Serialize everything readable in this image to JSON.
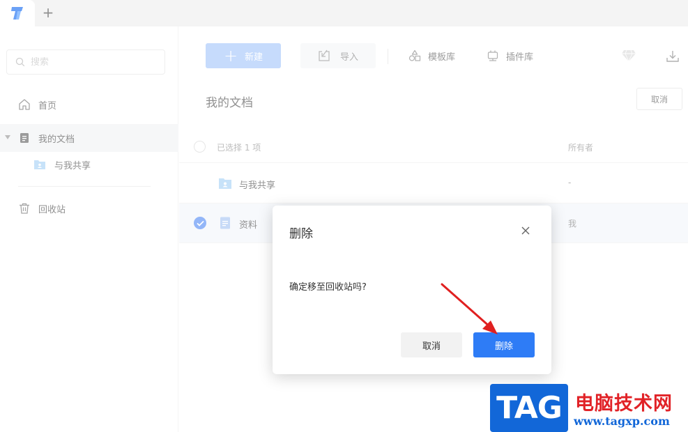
{
  "tabbar": {
    "logo": "app-logo-icon",
    "new_tab": "+"
  },
  "sidebar": {
    "search_placeholder": "搜索",
    "items": [
      {
        "label": "首页",
        "icon": "home-icon"
      },
      {
        "label": "我的文档",
        "icon": "document-icon"
      },
      {
        "label": "与我共享",
        "icon": "shared-folder-icon"
      },
      {
        "label": "回收站",
        "icon": "trash-icon"
      }
    ]
  },
  "toolbar": {
    "new_label": "新建",
    "import_label": "导入",
    "template_label": "模板库",
    "plugin_label": "插件库"
  },
  "main": {
    "title": "我的文档",
    "cancel_label": "取消",
    "selected_text": "已选择 1 项",
    "owner_header": "所有者",
    "rows": [
      {
        "name": "与我共享",
        "owner": "-",
        "type": "folder"
      },
      {
        "name": "资料",
        "owner": "我",
        "type": "document",
        "checked": true
      }
    ]
  },
  "dialog": {
    "title": "删除",
    "message": "确定移至回收站吗?",
    "cancel_label": "取消",
    "confirm_label": "删除"
  },
  "watermark": {
    "tag": "TAG",
    "cn": "电脑技术网",
    "url": "www.tagxp.com"
  },
  "colors": {
    "primary": "#2e7cf6",
    "primary_disabled": "#a8c8fb",
    "annotation_arrow": "#e02020"
  }
}
